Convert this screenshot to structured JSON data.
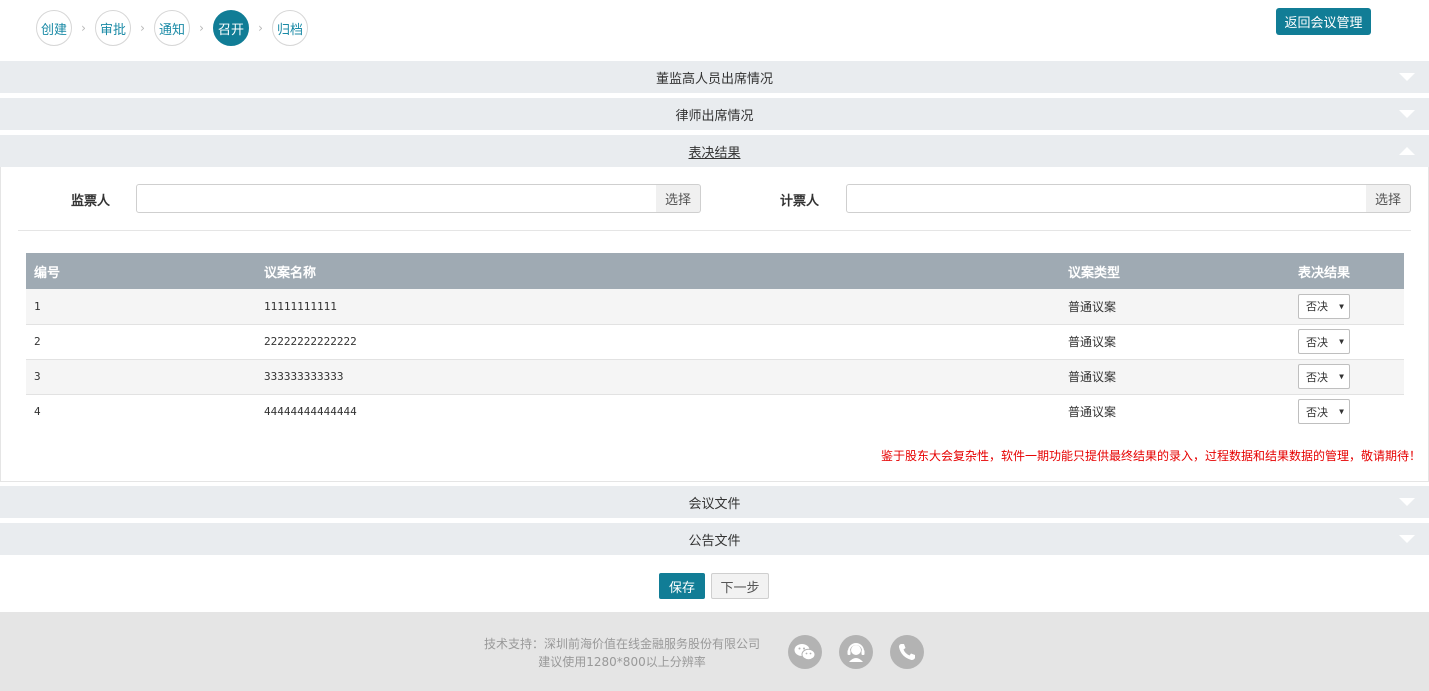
{
  "steps": [
    {
      "label": "创建",
      "active": false
    },
    {
      "label": "审批",
      "active": false
    },
    {
      "label": "通知",
      "active": false
    },
    {
      "label": "召开",
      "active": true
    },
    {
      "label": "归档",
      "active": false
    }
  ],
  "step_separator": "›",
  "header": {
    "back_button": "返回会议管理"
  },
  "sections": {
    "directors": "董监高人员出席情况",
    "lawyers": "律师出席情况",
    "voting": "表决结果",
    "meeting_files": "会议文件",
    "announcement_files": "公告文件"
  },
  "voting": {
    "scrutineer_label": "监票人",
    "scrutineer_value": "",
    "counter_label": "计票人",
    "counter_value": "",
    "select_button": "选择",
    "columns": [
      "编号",
      "议案名称",
      "议案类型",
      "表决结果"
    ],
    "rows": [
      {
        "no": "1",
        "name": "11111111111",
        "type": "普通议案",
        "result": "否决"
      },
      {
        "no": "2",
        "name": "22222222222222",
        "type": "普通议案",
        "result": "否决"
      },
      {
        "no": "3",
        "name": "333333333333",
        "type": "普通议案",
        "result": "否决"
      },
      {
        "no": "4",
        "name": "44444444444444",
        "type": "普通议案",
        "result": "否决"
      }
    ],
    "notice": "鉴于股东大会复杂性，软件一期功能只提供最终结果的录入，过程数据和结果数据的管理，敬请期待！"
  },
  "actions": {
    "save": "保存",
    "next": "下一步"
  },
  "footer": {
    "line1": "技术支持：深圳前海价值在线金融服务股份有限公司",
    "line2": "建议使用1280*800以上分辨率",
    "icons": [
      "wechat-icon",
      "customer-service-icon",
      "phone-icon"
    ]
  },
  "colors": {
    "primary": "#117d96",
    "notice": "#e60000",
    "table_header": "#9faab3"
  }
}
